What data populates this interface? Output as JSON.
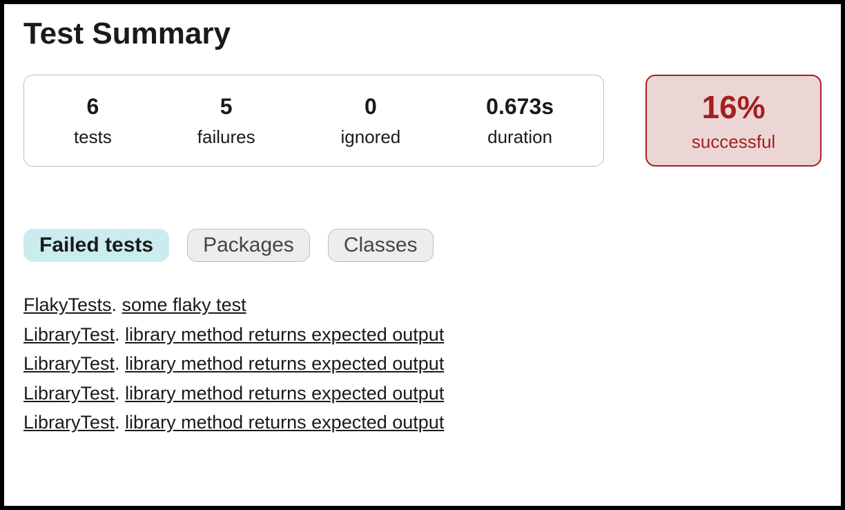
{
  "title": "Test Summary",
  "metrics": {
    "tests": {
      "value": "6",
      "label": "tests"
    },
    "failures": {
      "value": "5",
      "label": "failures"
    },
    "ignored": {
      "value": "0",
      "label": "ignored"
    },
    "duration": {
      "value": "0.673s",
      "label": "duration"
    }
  },
  "success": {
    "percent": "16%",
    "label": "successful"
  },
  "tabs": {
    "failed": "Failed tests",
    "packages": "Packages",
    "classes": "Classes"
  },
  "failedTests": [
    {
      "class": "FlakyTests",
      "name": "some flaky test"
    },
    {
      "class": "LibraryTest",
      "name": "library method returns expected output"
    },
    {
      "class": "LibraryTest",
      "name": "library method returns expected output"
    },
    {
      "class": "LibraryTest",
      "name": "library method returns expected output"
    },
    {
      "class": "LibraryTest",
      "name": "library method returns expected output"
    }
  ]
}
